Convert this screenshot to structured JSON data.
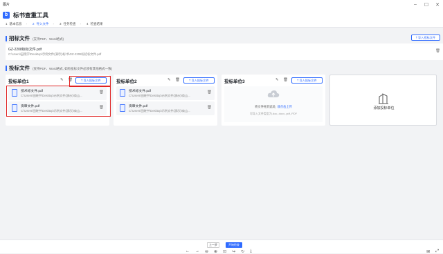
{
  "window": {
    "title": "图片"
  },
  "app": {
    "title": "标书查重工具"
  },
  "steps": [
    {
      "num": "1",
      "label": "基本信息"
    },
    {
      "num": "2",
      "label": "导入文件"
    },
    {
      "num": "3",
      "label": "任务检查"
    },
    {
      "num": "4",
      "label": "检查结果"
    }
  ],
  "tender": {
    "title": "招标文件",
    "hint": "(支持PDF、Word格式)",
    "import_label": "导入招标文件",
    "file": {
      "name": "GZ-2208标标文件.pdf",
      "path": "C:\\Users\\田晓宇\\Desktop\\示例文件(演示)\\标书\\GZ-2208标招标文件.pdf"
    }
  },
  "bids": {
    "title": "投标文件",
    "hint": "(支持PDF、Word格式, 如有投标文件必须有其他格式一致)",
    "import_label": "导入投标文件",
    "units": [
      {
        "title": "投标单位1",
        "files": [
          {
            "name": "技术标文件.pdf",
            "path": "C:\\Users\\田晓宇\\Desktop\\示例文件(演示)\\商山..."
          },
          {
            "name": "资审文件.pdf",
            "path": "C:\\Users\\田晓宇\\Desktop\\示例文件(演示)\\商山..."
          }
        ]
      },
      {
        "title": "投标单位2",
        "files": [
          {
            "name": "技术标文件.pdf",
            "path": "C:\\Users\\田晓宇\\Desktop\\示例文件(演示)\\商山..."
          },
          {
            "name": "资审文件.pdf",
            "path": "C:\\Users\\田晓宇\\Desktop\\示例文件(演示)\\商山..."
          }
        ]
      },
      {
        "title": "投标单位3",
        "upload": {
          "text": "将文件拖到此处, ",
          "link": "或点击上传",
          "formats": "可导入文件类型为.doc,.docx,.pdf,.PDF"
        }
      }
    ],
    "add_unit_label": "添加投标单位"
  },
  "footer": {
    "prev_label": "上一步",
    "start_label": "开始检查"
  },
  "colors": {
    "accent": "#2f6bff",
    "highlight": "#e02424"
  }
}
